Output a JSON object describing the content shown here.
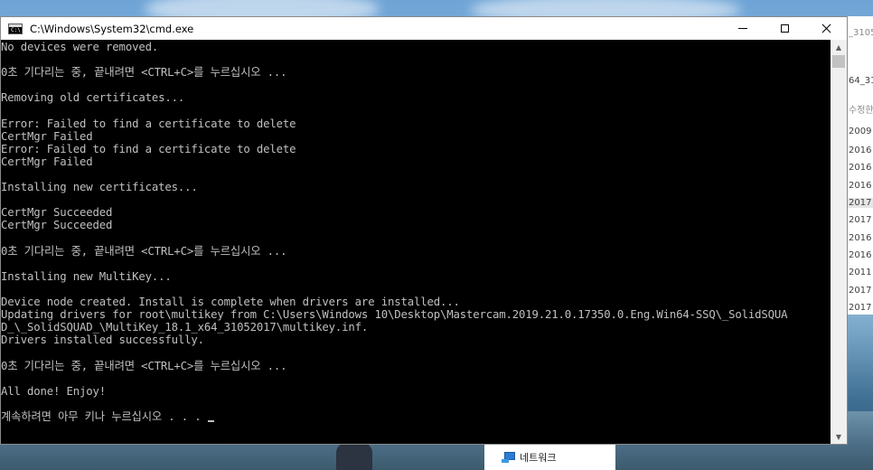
{
  "window": {
    "title": "C:\\Windows\\System32\\cmd.exe",
    "minimize_label": "",
    "maximize_label": "",
    "close_label": ""
  },
  "console": {
    "lines": [
      "No devices were removed.",
      "",
      "0초 기다리는 중, 끝내려면 <CTRL+C>를 누르십시오 ...",
      "",
      "Removing old certificates...",
      "",
      "Error: Failed to find a certificate to delete",
      "CertMgr Failed",
      "Error: Failed to find a certificate to delete",
      "CertMgr Failed",
      "",
      "Installing new certificates...",
      "",
      "CertMgr Succeeded",
      "CertMgr Succeeded",
      "",
      "0초 기다리는 중, 끝내려면 <CTRL+C>를 누르십시오 ...",
      "",
      "Installing new MultiKey...",
      "",
      "Device node created. Install is complete when drivers are installed...",
      "Updating drivers for root\\multikey from C:\\Users\\Windows 10\\Desktop\\Mastercam.2019.21.0.17350.0.Eng.Win64-SSQ\\_SolidSQUA",
      "D_\\_SolidSQUAD_\\MultiKey_18.1_x64_31052017\\multikey.inf.",
      "Drivers installed successfully.",
      "",
      "0초 기다리는 중, 끝내려면 <CTRL+C>를 누르십시오 ...",
      "",
      "All done! Enjoy!",
      "",
      "계속하려면 아무 키나 누르십시오 . . . "
    ]
  },
  "explorer": {
    "rows": [
      "_3105",
      "64_31",
      "수정한",
      "2009",
      "2016",
      "2016",
      "2016",
      "2017",
      "2017",
      "2016",
      "2016",
      "2011",
      "2017",
      "2017"
    ],
    "nav_item": "네트워크"
  }
}
